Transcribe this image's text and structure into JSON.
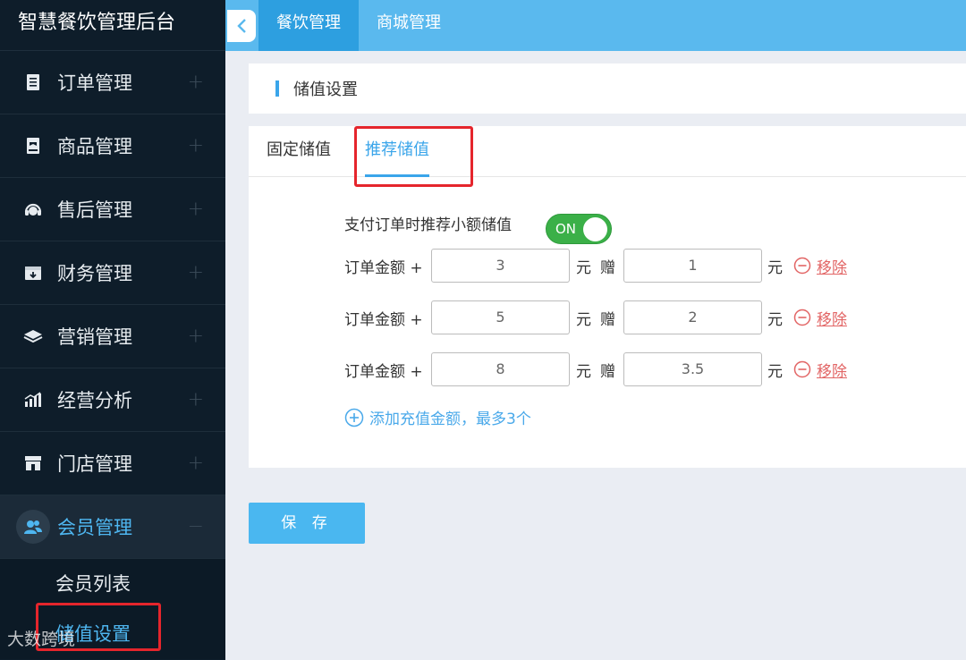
{
  "app": {
    "title": "智慧餐饮管理后台"
  },
  "sidebar": {
    "items": [
      {
        "label": "订单管理",
        "icon": "clipboard-icon"
      },
      {
        "label": "商品管理",
        "icon": "tag-icon"
      },
      {
        "label": "售后管理",
        "icon": "headset-icon"
      },
      {
        "label": "财务管理",
        "icon": "wallet-icon"
      },
      {
        "label": "营销管理",
        "icon": "layers-icon"
      },
      {
        "label": "经营分析",
        "icon": "chart-icon"
      },
      {
        "label": "门店管理",
        "icon": "store-icon"
      },
      {
        "label": "会员管理",
        "icon": "members-icon"
      }
    ],
    "sub_items": [
      {
        "label": "会员列表"
      },
      {
        "label": "储值设置"
      }
    ]
  },
  "topbar": {
    "tabs": [
      {
        "label": "餐饮管理"
      },
      {
        "label": "商城管理"
      }
    ]
  },
  "header": {
    "title": "储值设置"
  },
  "tabs": [
    {
      "label": "固定储值"
    },
    {
      "label": "推荐储值"
    }
  ],
  "form": {
    "toggle_label": "支付订单时推荐小额储值",
    "toggle_state": "ON",
    "row_label": "订单金额 +",
    "unit": "元",
    "gift_label": "赠",
    "remove_label": "移除",
    "rows": [
      {
        "amount": "3",
        "gift": "1"
      },
      {
        "amount": "5",
        "gift": "2"
      },
      {
        "amount": "8",
        "gift": "3.5"
      }
    ],
    "add_label": "添加充值金额，最多3个"
  },
  "actions": {
    "save_label": "保 存"
  },
  "watermark": "大数跨境",
  "colors": {
    "accent": "#3aa5ea",
    "toggle_on": "#3bb048",
    "remove": "#e26565",
    "highlight": "#e5252c"
  }
}
